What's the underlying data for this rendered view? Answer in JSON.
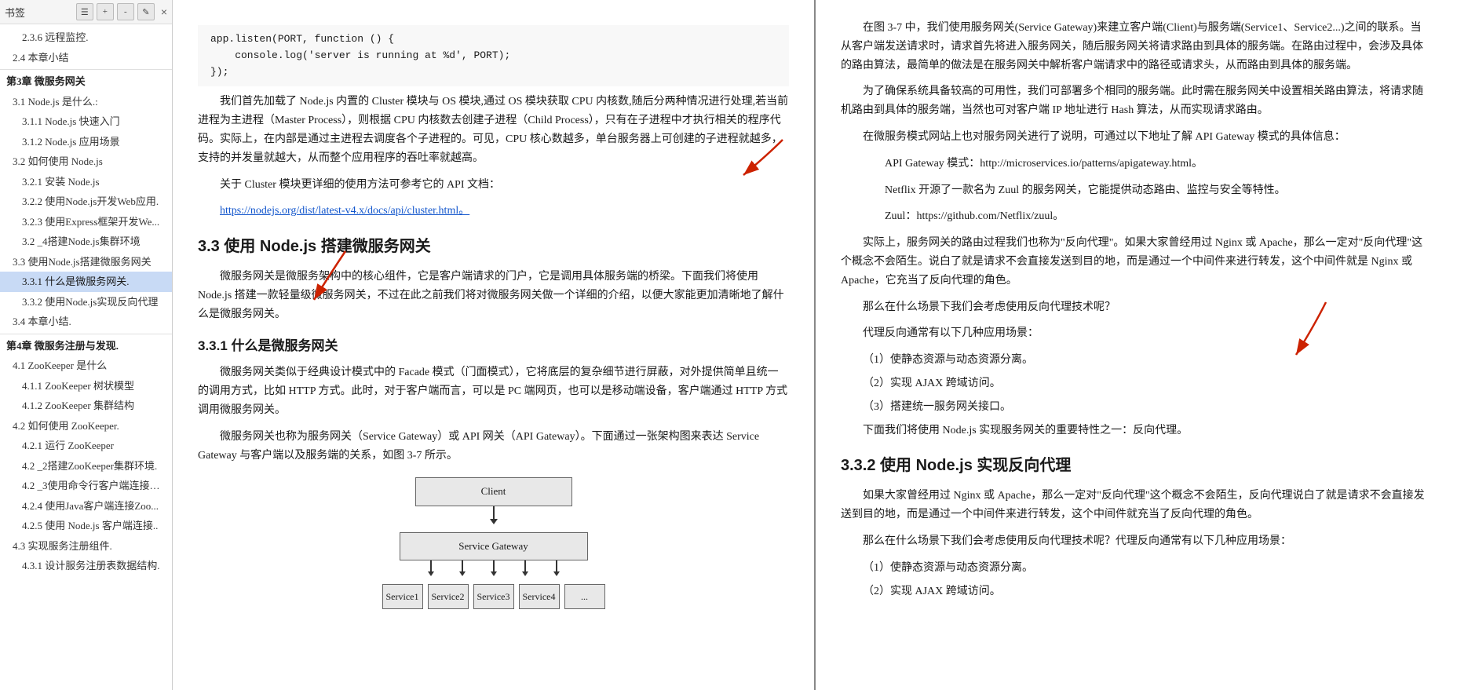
{
  "sidebar": {
    "label": "书签",
    "toolbar_icons": [
      "bookmark-list",
      "bookmark-add",
      "bookmark-remove",
      "bookmark-edit"
    ],
    "close_label": "×",
    "items": [
      {
        "id": "2.3.6",
        "label": "2.3.6 远程监控.",
        "level": 3,
        "active": false
      },
      {
        "id": "2.4",
        "label": "2.4 本章小结",
        "level": 2,
        "active": false
      },
      {
        "id": "ch3",
        "label": "第3章 微服务网关",
        "level": 1,
        "active": false
      },
      {
        "id": "3.1",
        "label": "3.1 Node.js 是什么.:",
        "level": 2,
        "active": false
      },
      {
        "id": "3.1.1",
        "label": "3.1.1 Node.js 快速入门",
        "level": 3,
        "active": false
      },
      {
        "id": "3.1.2",
        "label": "3.1.2 Node.js 应用场景",
        "level": 3,
        "active": false
      },
      {
        "id": "3.2",
        "label": "3.2 如何使用 Node.js",
        "level": 2,
        "active": false
      },
      {
        "id": "3.2.1",
        "label": "3.2.1 安装 Node.js",
        "level": 3,
        "active": false
      },
      {
        "id": "3.2.2",
        "label": "3.2.2 使用Node.js开发Web应用.",
        "level": 3,
        "active": false
      },
      {
        "id": "3.2.3",
        "label": "3.2.3 使用Express框架开发We...",
        "level": 3,
        "active": false
      },
      {
        "id": "3.2_4",
        "label": "3.2 _4搭建Node.js集群环境",
        "level": 3,
        "active": false
      },
      {
        "id": "3.3",
        "label": "3.3 使用Node.js搭建微服务网关",
        "level": 2,
        "active": false
      },
      {
        "id": "3.3.1",
        "label": "3.3.1 什么是微服务网关.",
        "level": 3,
        "active": true
      },
      {
        "id": "3.3.2",
        "label": "3.3.2 使用Node.js实现反向代理",
        "level": 3,
        "active": false
      },
      {
        "id": "3.4",
        "label": "3.4 本章小结.",
        "level": 2,
        "active": false
      },
      {
        "id": "ch4",
        "label": "第4章 微服务注册与发现.",
        "level": 1,
        "active": false
      },
      {
        "id": "4.1",
        "label": "4.1 ZooKeeper 是什么",
        "level": 2,
        "active": false
      },
      {
        "id": "4.1.1",
        "label": "4.1.1 ZooKeeper 树状模型",
        "level": 3,
        "active": false
      },
      {
        "id": "4.1.2",
        "label": "4.1.2 ZooKeeper 集群结构",
        "level": 3,
        "active": false
      },
      {
        "id": "4.2",
        "label": "4.2 如何使用 ZooKeeper.",
        "level": 2,
        "active": false
      },
      {
        "id": "4.2.1",
        "label": "4.2.1 运行 ZooKeeper",
        "level": 3,
        "active": false
      },
      {
        "id": "4.2_2",
        "label": "4.2 _2搭建ZooKeeper集群环境.",
        "level": 3,
        "active": false
      },
      {
        "id": "4.2_3",
        "label": "4.2 _3使用命令行客户端连接ZooK...",
        "level": 3,
        "active": false
      },
      {
        "id": "4.2.4",
        "label": "4.2.4 使用Java客户端连接Zoo...",
        "level": 3,
        "active": false
      },
      {
        "id": "4.2.5",
        "label": "4.2.5 使用 Node.js 客户端连接..",
        "level": 3,
        "active": false
      },
      {
        "id": "4.3",
        "label": "4.3 实现服务注册组件.",
        "level": 2,
        "active": false
      },
      {
        "id": "4.3.1",
        "label": "4.3.1 设计服务注册表数据结构.",
        "level": 3,
        "active": false
      }
    ]
  },
  "left_page": {
    "code_lines": [
      "app.listen(PORT, function () {",
      "    console.log('server is running at %d', PORT);",
      "});"
    ],
    "para1": "我们首先加载了 Node.js 内置的 Cluster 模块与 OS 模块,通过 OS 模块获取 CPU 内核数,随后分两种情况进行处理,若当前进程为主进程（Master Process），则根据 CPU 内核数去创建子进程（Child Process），只有在子进程中才执行相关的程序代码。实际上，在内部是通过主进程去调度各个子进程的。可见，CPU 核心数越多，单台服务器上可创建的子进程就越多，支持的并发量就越大，从而整个应用程序的吞吐率就越高。",
    "para2": "关于 Cluster 模块更详细的使用方法可参考它的 API 文档：",
    "link": "https://nodejs.org/dist/latest-v4.x/docs/api/cluster.html。",
    "section_33_title": "3.3   使用 Node.js 搭建微服务网关",
    "section_33_para": "微服务网关是微服务架构中的核心组件，它是客户端请求的门户，它是调用具体服务端的桥梁。下面我们将使用 Node.js 搭建一款轻量级微服务网关，不过在此之前我们将对微服务网关做一个详细的介绍，以便大家能更加清晰地了解什么是微服务网关。",
    "section_331_title": "3.3.1   什么是微服务网关",
    "section_331_para1": "微服务网关类似于经典设计模式中的 Facade 模式（门面模式），它将底层的复杂细节进行屏蔽，对外提供简单且统一的调用方式，比如 HTTP 方式。此时，对于客户端而言，可以是 PC 端网页，也可以是移动端设备，客户端通过 HTTP 方式调用微服务网关。",
    "section_331_para2": "微服务网关也称为服务网关（Service Gateway）或 API 网关（API Gateway）。下面通过一张架构图来表达 Service Gateway 与客户端以及服务端的关系，如图 3-7 所示。",
    "diagram": {
      "client_label": "Client",
      "gateway_label": "Service Gateway",
      "services": [
        "Service1",
        "Service2",
        "Service3",
        "Service4",
        "..."
      ]
    }
  },
  "right_page": {
    "para_intro": "在图 3-7 中，我们使用服务网关(Service Gateway)来建立客户端(Client)与服务端(Service1、Service2...)之间的联系。当从客户端发送请求时，请求首先将进入服务网关，随后服务网关将请求路由到具体的服务端。在路由过程中，会涉及具体的路由算法，最简单的做法是在服务网关中解析客户端请求中的路径或请求头，从而路由到具体的服务端。",
    "para_ha": "为了确保系统具备较高的可用性，我们可部署多个相同的服务端。此时需在服务网关中设置相关路由算法，将请求随机路由到具体的服务端，当然也可对客户端 IP 地址进行 Hash 算法，从而实现请求路由。",
    "para_explained": "在微服务模式网站上也对服务网关进行了说明，可通过以下地址了解 API Gateway 模式的具体信息：",
    "api_gateway_link": "API Gateway 模式：http://microservices.io/patterns/apigateway.html。",
    "netflix_text": "Netflix 开源了一款名为 Zuul 的服务网关，它能提供动态路由、监控与安全等特性。",
    "zuul_link": "Zuul：https://github.com/Netflix/zuul。",
    "reverse_proxy_para": "实际上，服务网关的路由过程我们也称为\"反向代理\"。如果大家曾经用过 Nginx 或 Apache，那么一定对\"反向代理\"这个概念不会陌生。说白了就是请求不会直接发送到目的地，而是通过一个中间件来进行转发，这个中间件就是 Nginx 或 Apache，它充当了反向代理的角色。",
    "when_para": "那么在什么场景下我们会考虑使用反向代理技术呢？",
    "scenarios_intro": "代理反向通常有以下几种应用场景：",
    "scenarios": [
      "（1）使静态资源与动态资源分离。",
      "（2）实现 AJAX 跨域访问。",
      "（3）搭建统一服务网关接口。"
    ],
    "nodejs_impl_para": "下面我们将使用 Node.js 实现服务网关的重要特性之一：反向代理。",
    "section_332_title": "3.3.2   使用 Node.js 实现反向代理",
    "section_332_para1": "如果大家曾经用过 Nginx 或 Apache，那么一定对\"反向代理\"这个概念不会陌生，反向代理说白了就是请求不会直接发送到目的地，而是通过一个中间件来进行转发，这个中间件就充当了反向代理的角色。",
    "section_332_para2": "那么在什么场景下我们会考虑使用反向代理技术呢？代理反向通常有以下几种应用场景：",
    "section_332_scenarios": [
      "（1）使静态资源与动态资源分离。",
      "（2）实现 AJAX 跨域访问。"
    ]
  },
  "colors": {
    "active_bg": "#c8daf5",
    "hover_bg": "#e8f0fe",
    "sidebar_bg": "#ffffff",
    "page_bg": "#ffffff",
    "arrow_red": "#cc0000"
  }
}
